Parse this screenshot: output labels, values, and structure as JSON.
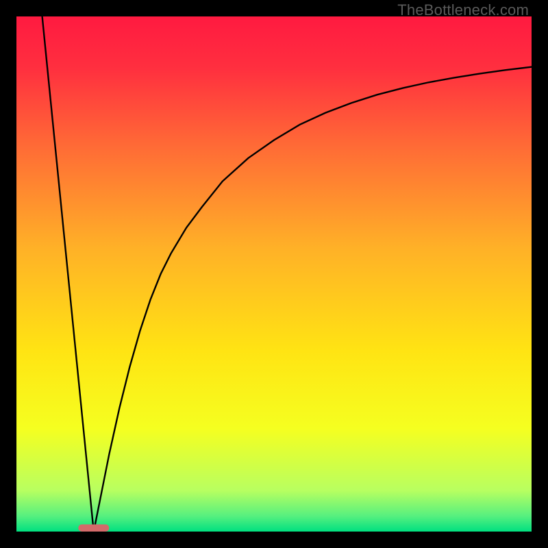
{
  "watermark": "TheBottleneck.com",
  "chart_data": {
    "type": "line",
    "title": "",
    "xlabel": "",
    "ylabel": "",
    "xlim": [
      0,
      100
    ],
    "ylim": [
      0,
      100
    ],
    "grid": false,
    "legend": false,
    "background": {
      "type": "vertical-gradient",
      "stops": [
        {
          "pos": 0.0,
          "color": "#ff1a40"
        },
        {
          "pos": 0.1,
          "color": "#ff2f3f"
        },
        {
          "pos": 0.25,
          "color": "#ff6a36"
        },
        {
          "pos": 0.45,
          "color": "#ffb127"
        },
        {
          "pos": 0.65,
          "color": "#ffe413"
        },
        {
          "pos": 0.8,
          "color": "#f5ff20"
        },
        {
          "pos": 0.92,
          "color": "#b8ff60"
        },
        {
          "pos": 0.97,
          "color": "#56f07f"
        },
        {
          "pos": 1.0,
          "color": "#00e080"
        }
      ]
    },
    "target_marker": {
      "x": 15,
      "y": 0,
      "width": 6,
      "height": 1.4,
      "color": "#d46a6a",
      "corner_radius": 0.7
    },
    "series": [
      {
        "name": "left-segment",
        "x": [
          5,
          15
        ],
        "y": [
          100,
          0
        ]
      },
      {
        "name": "right-curve",
        "x": [
          15,
          18,
          20,
          22,
          24,
          26,
          28,
          30,
          33,
          36,
          40,
          45,
          50,
          55,
          60,
          65,
          70,
          75,
          80,
          85,
          90,
          95,
          100
        ],
        "y": [
          0,
          15,
          24,
          32,
          39,
          45,
          50,
          54,
          59,
          63,
          68,
          72.5,
          76,
          79,
          81.3,
          83.2,
          84.8,
          86.1,
          87.2,
          88.1,
          88.9,
          89.6,
          90.2
        ]
      }
    ]
  }
}
